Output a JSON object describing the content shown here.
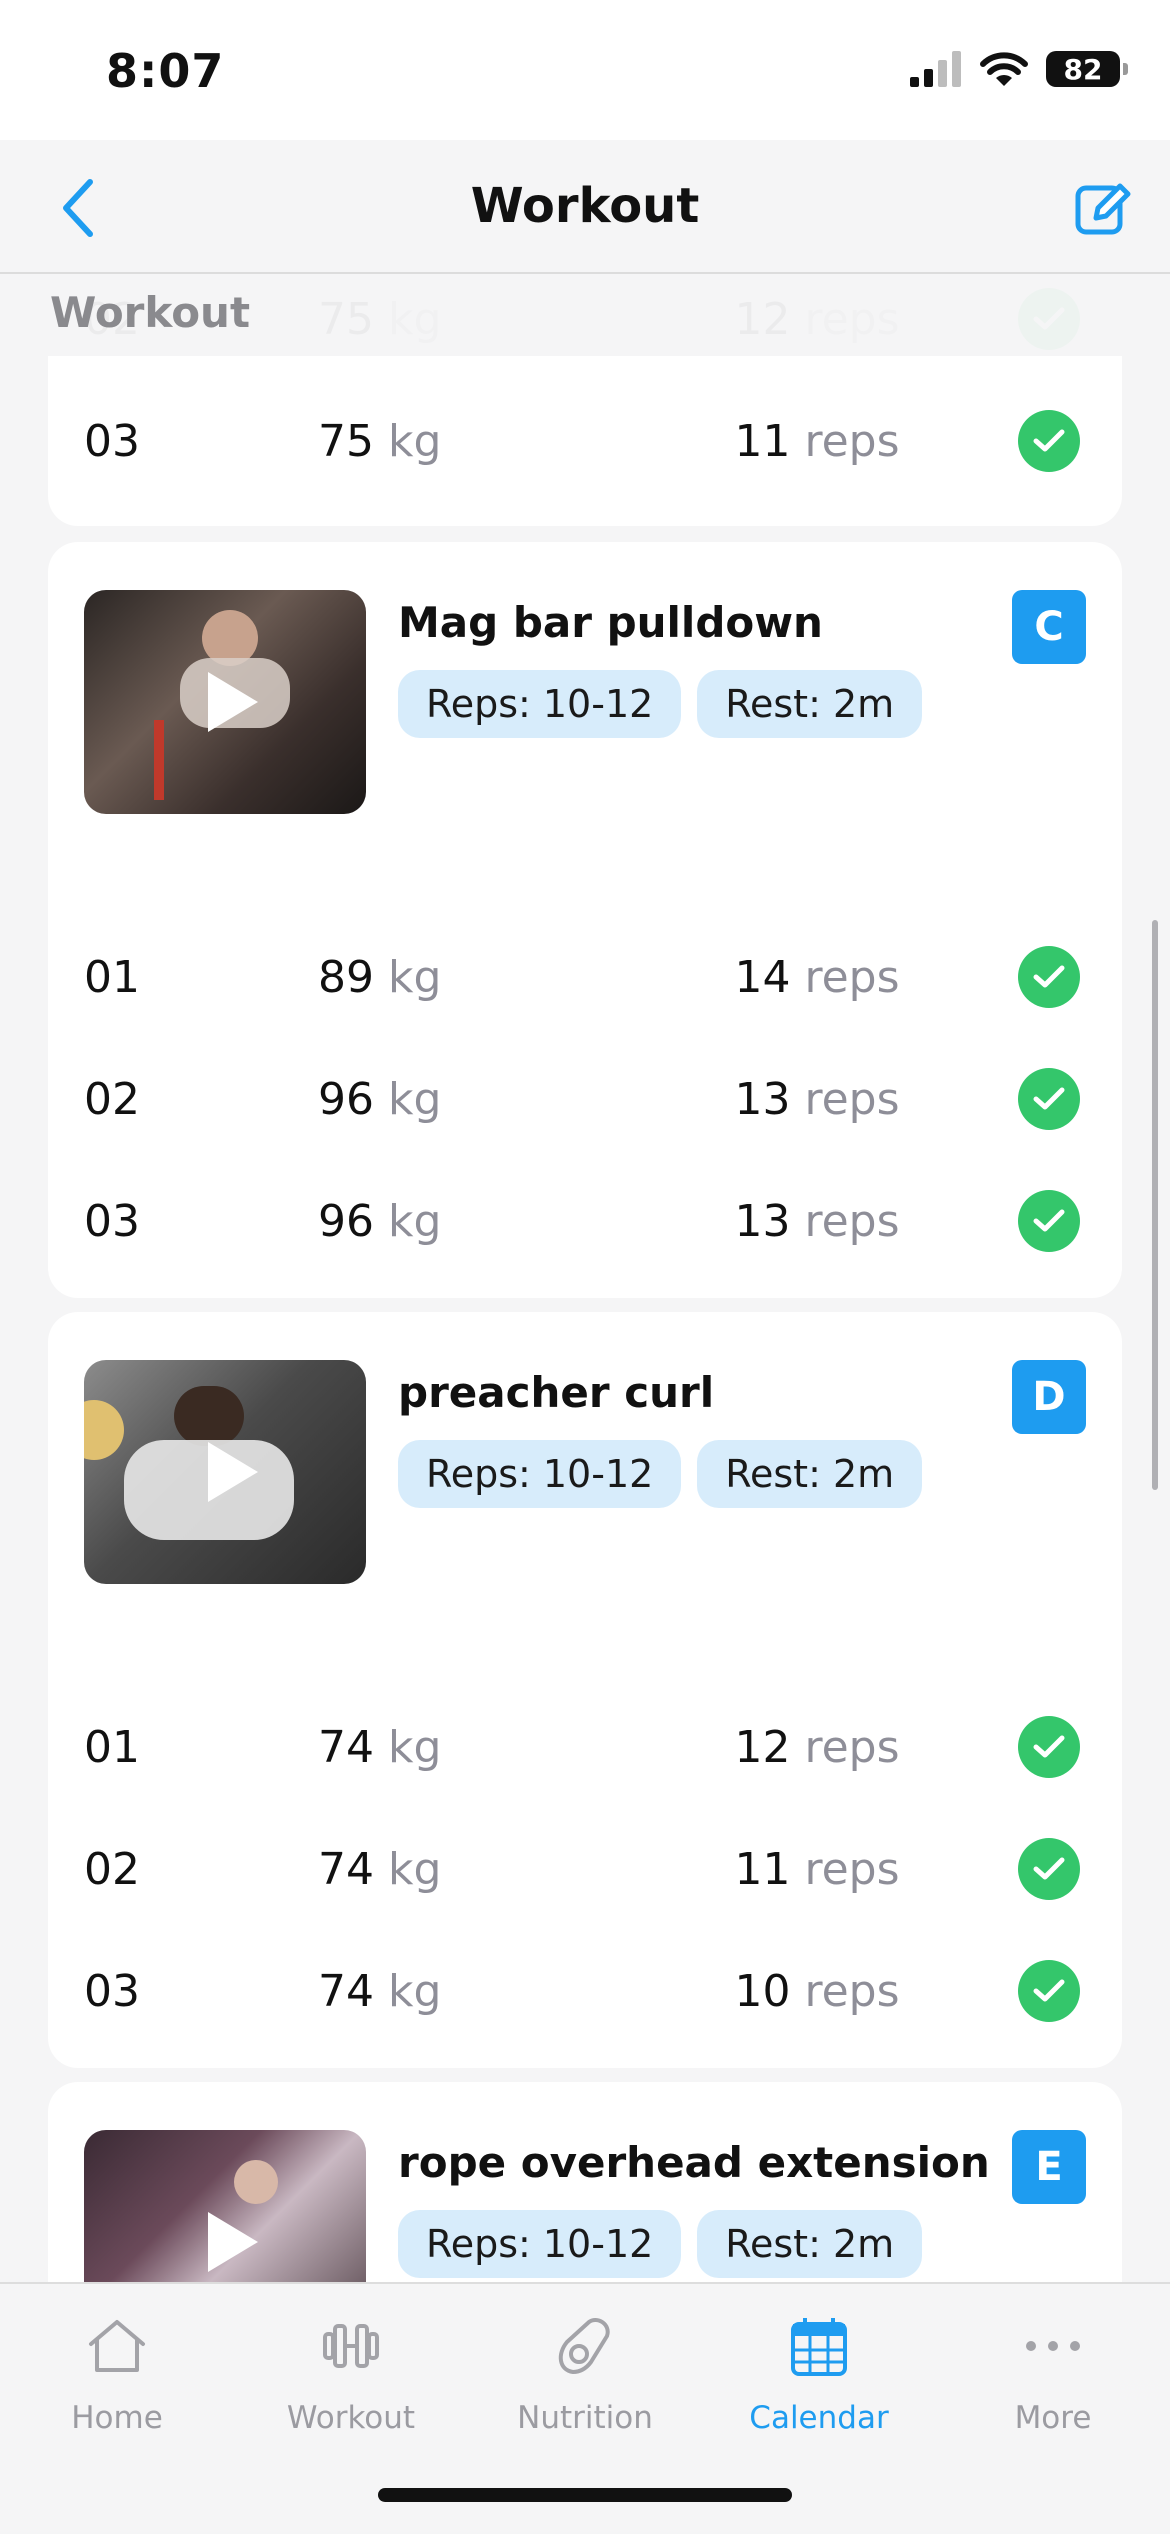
{
  "status_bar": {
    "time": "8:07",
    "battery": "82"
  },
  "nav": {
    "title": "Workout",
    "back_icon": "chevron-left-icon",
    "edit_icon": "edit-icon"
  },
  "section": {
    "label": "Workout"
  },
  "colors": {
    "accent": "#1e9cf0",
    "check": "#34c66b",
    "chip_bg": "#d7ecfb"
  },
  "first_card": {
    "sets": [
      {
        "num": "02",
        "weight": "75",
        "unit": "kg",
        "reps": "12",
        "reps_unit": "reps"
      },
      {
        "num": "03",
        "weight": "75",
        "unit": "kg",
        "reps": "11",
        "reps_unit": "reps"
      }
    ]
  },
  "exercises": [
    {
      "name": "Mag bar pulldown",
      "letter": "C",
      "reps_chip": "Reps: 10-12",
      "rest_chip": "Rest: 2m",
      "sets": [
        {
          "num": "01",
          "weight": "89",
          "unit": "kg",
          "reps": "14",
          "reps_unit": "reps"
        },
        {
          "num": "02",
          "weight": "96",
          "unit": "kg",
          "reps": "13",
          "reps_unit": "reps"
        },
        {
          "num": "03",
          "weight": "96",
          "unit": "kg",
          "reps": "13",
          "reps_unit": "reps"
        }
      ]
    },
    {
      "name": "preacher curl",
      "letter": "D",
      "reps_chip": "Reps: 10-12",
      "rest_chip": "Rest: 2m",
      "sets": [
        {
          "num": "01",
          "weight": "74",
          "unit": "kg",
          "reps": "12",
          "reps_unit": "reps"
        },
        {
          "num": "02",
          "weight": "74",
          "unit": "kg",
          "reps": "11",
          "reps_unit": "reps"
        },
        {
          "num": "03",
          "weight": "74",
          "unit": "kg",
          "reps": "10",
          "reps_unit": "reps"
        }
      ]
    },
    {
      "name": "rope overhead extension",
      "letter": "E",
      "reps_chip": "Reps: 10-12",
      "rest_chip": "Rest: 2m",
      "sets": []
    }
  ],
  "tabs": [
    {
      "label": "Home",
      "icon": "home-icon"
    },
    {
      "label": "Workout",
      "icon": "dumbbell-icon"
    },
    {
      "label": "Nutrition",
      "icon": "avocado-icon"
    },
    {
      "label": "Calendar",
      "icon": "calendar-icon",
      "active": true
    },
    {
      "label": "More",
      "icon": "more-icon"
    }
  ]
}
